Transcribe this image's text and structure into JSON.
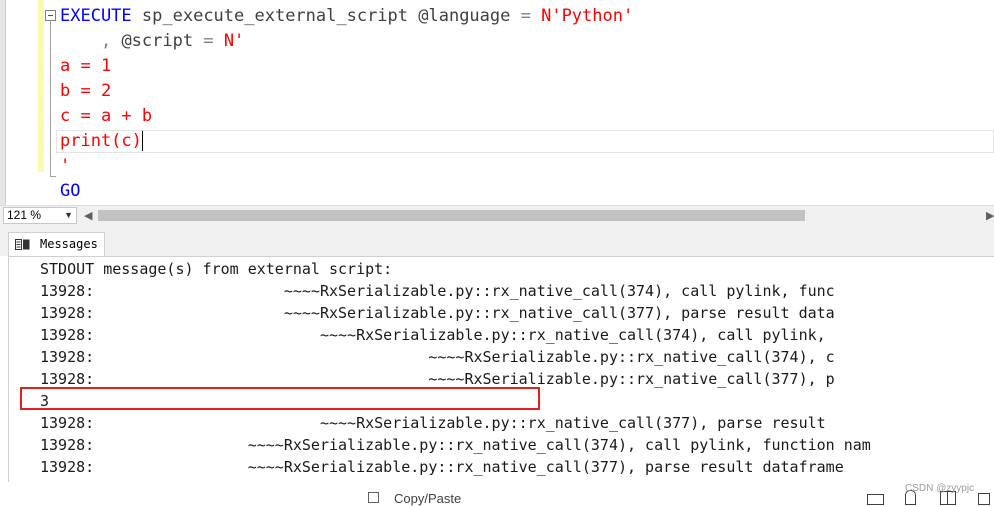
{
  "editor": {
    "lines": [
      {
        "parts": [
          {
            "t": "EXECUTE",
            "c": "kw"
          },
          {
            "t": " ",
            "c": "var"
          },
          {
            "t": "sp_execute_external_script",
            "c": "var"
          },
          {
            "t": " @language ",
            "c": "var"
          },
          {
            "t": "=",
            "c": "op"
          },
          {
            "t": " N'Python'",
            "c": "str"
          }
        ]
      },
      {
        "parts": [
          {
            "t": "    ",
            "c": "var"
          },
          {
            "t": ",",
            "c": "op"
          },
          {
            "t": " @script ",
            "c": "var"
          },
          {
            "t": "=",
            "c": "op"
          },
          {
            "t": " N'",
            "c": "str"
          }
        ]
      },
      {
        "parts": [
          {
            "t": "a = 1",
            "c": "str"
          }
        ]
      },
      {
        "parts": [
          {
            "t": "b = 2",
            "c": "str"
          }
        ]
      },
      {
        "parts": [
          {
            "t": "c = a + b",
            "c": "str"
          }
        ]
      },
      {
        "parts": [
          {
            "t": "print(c)",
            "c": "str"
          }
        ],
        "caret": true
      },
      {
        "parts": [
          {
            "t": "'",
            "c": "str"
          }
        ]
      },
      {
        "parts": [
          {
            "t": "GO",
            "c": "kw"
          }
        ]
      }
    ]
  },
  "zoom": {
    "value": "121 %"
  },
  "results": {
    "tab_label": "Messages",
    "lines": [
      "STDOUT message(s) from external script:",
      "13928:                     ~~~~RxSerializable.py::rx_native_call(374), call pylink, func",
      "13928:                     ~~~~RxSerializable.py::rx_native_call(377), parse result data",
      "13928:                         ~~~~RxSerializable.py::rx_native_call(374), call pylink, ",
      "13928:                                     ~~~~RxSerializable.py::rx_native_call(374), c",
      "13928:                                     ~~~~RxSerializable.py::rx_native_call(377), p",
      "3",
      "13928:                         ~~~~RxSerializable.py::rx_native_call(377), parse result ",
      "13928:                 ~~~~RxSerializable.py::rx_native_call(374), call pylink, function nam",
      "13928:                 ~~~~RxSerializable.py::rx_native_call(377), parse result dataframe"
    ],
    "highlight_color": "#e0221e"
  },
  "bottom": {
    "copy_paste_label": "Copy/Paste",
    "watermark": "CSDN @zyypjc"
  },
  "icons": [
    "fold-collapse-icon",
    "zoom-dropdown-arrow-icon",
    "scroll-left-icon",
    "scroll-right-icon",
    "messages-grid-icon",
    "copy-paste-icon"
  ]
}
